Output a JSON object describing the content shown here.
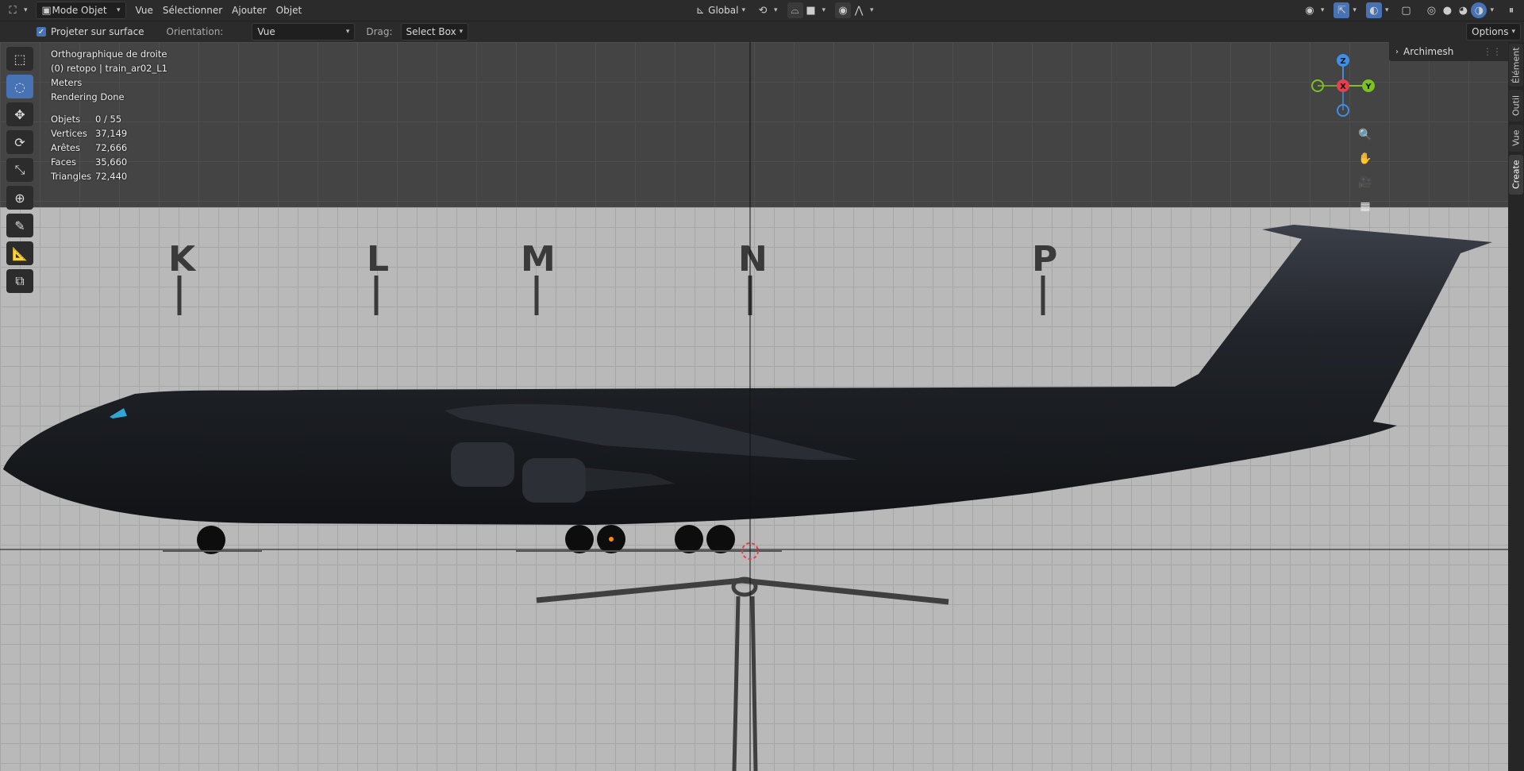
{
  "header": {
    "editor_type_icon": "view3d-icon",
    "mode": "Mode Objet",
    "menus": [
      "Vue",
      "Sélectionner",
      "Ajouter",
      "Objet"
    ],
    "transform_orientation": "Global",
    "options_label": "Options"
  },
  "tool_settings": {
    "project_surface_label": "Projeter sur surface",
    "orientation_label": "Orientation:",
    "orientation_value": "Vue",
    "drag_label": "Drag:",
    "drag_value": "Select Box"
  },
  "overlay": {
    "view_name": "Orthographique de droite",
    "object_info": "(0) retopo | train_ar02_L1",
    "units": "Meters",
    "render_status": "Rendering Done",
    "stats": [
      {
        "label": "Objets",
        "value": "0 / 55"
      },
      {
        "label": "Vertices",
        "value": "37,149"
      },
      {
        "label": "Arêtes",
        "value": "72,666"
      },
      {
        "label": "Faces",
        "value": "35,660"
      },
      {
        "label": "Triangles",
        "value": "72,440"
      }
    ]
  },
  "gizmo": {
    "z": "Z",
    "x": "X",
    "y": "Y"
  },
  "blueprint_letters": [
    "K",
    "L",
    "M",
    "N",
    "P"
  ],
  "side_panel": {
    "header": "Archimesh",
    "tabs": [
      "Élément",
      "Outil",
      "Vue",
      "Create"
    ]
  },
  "colors": {
    "accent": "#4772b3",
    "x_axis": "#e5404f",
    "y_axis": "#7ec221",
    "z_axis": "#3f8fe5"
  }
}
